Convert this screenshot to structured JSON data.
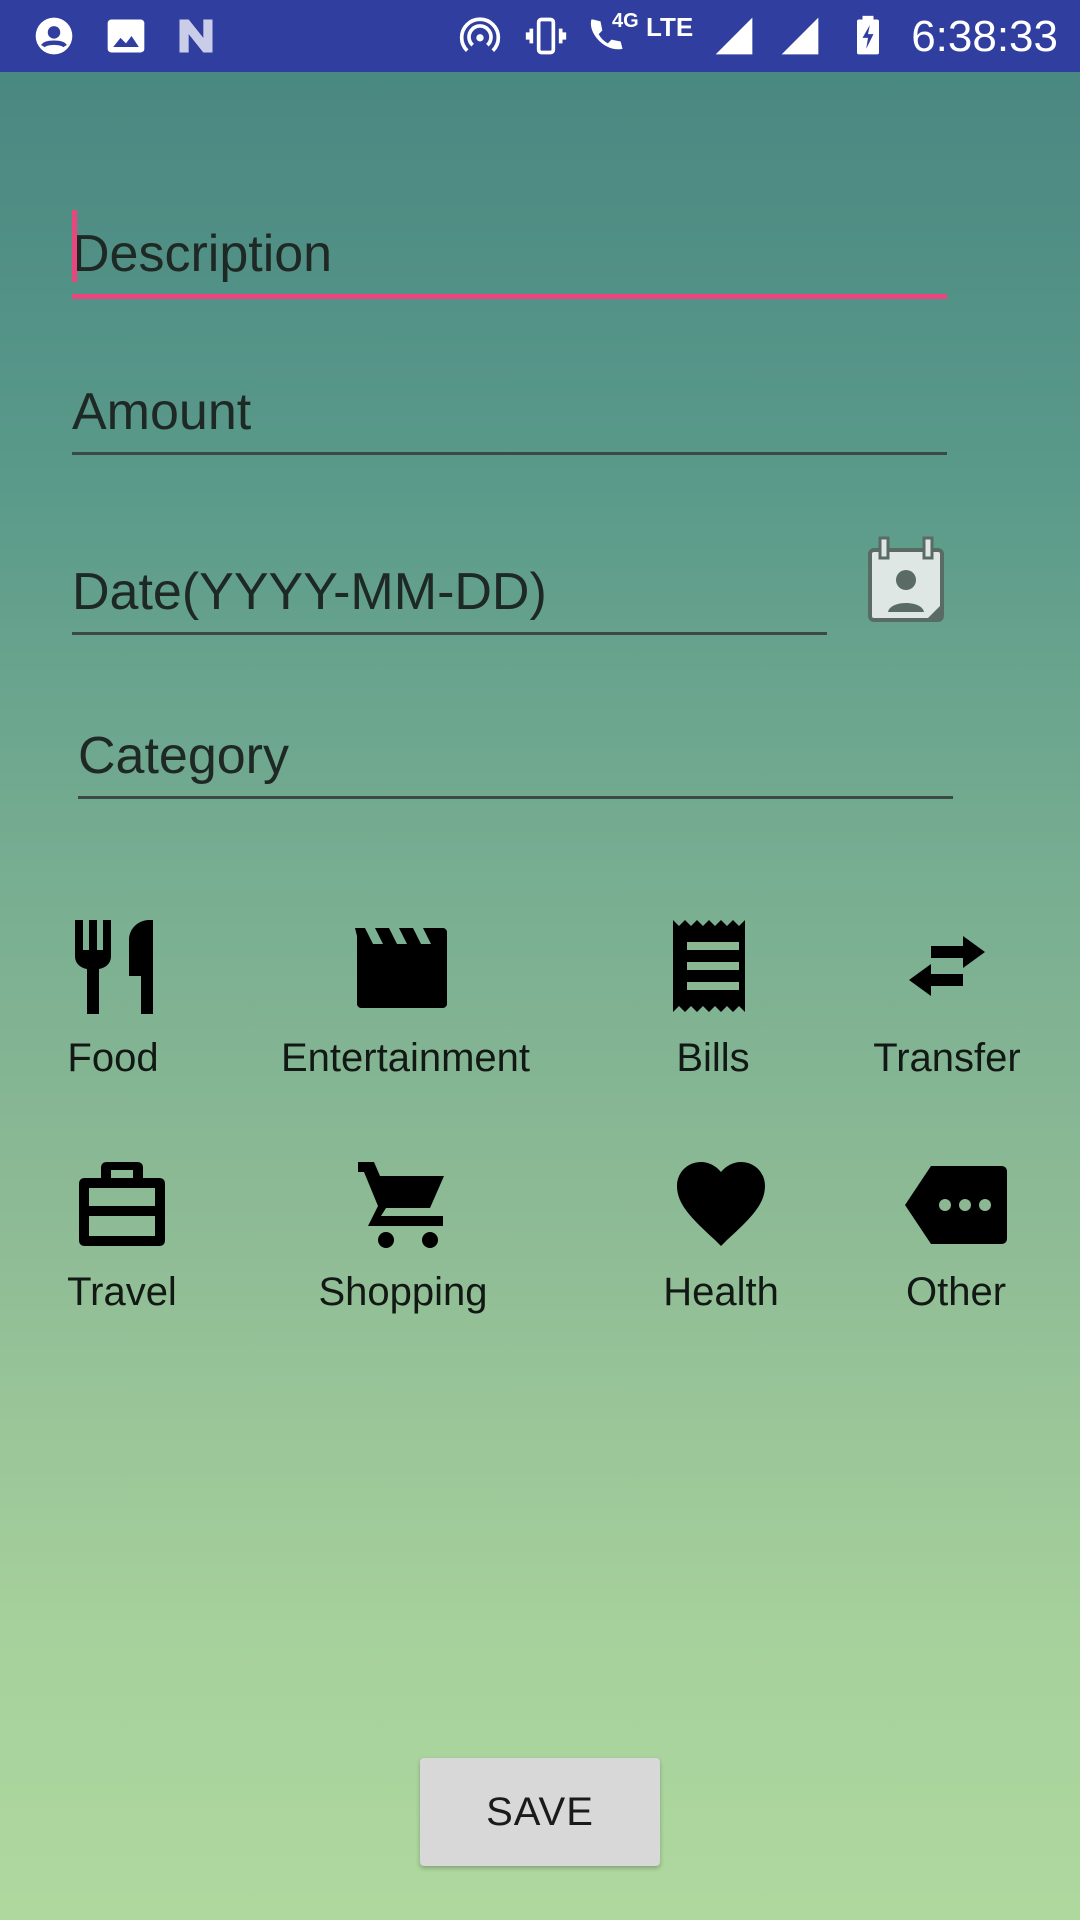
{
  "status_bar": {
    "time": "6:38:33",
    "network_4g": "4G",
    "network_lte": "LTE",
    "icons": [
      "account-circle-icon",
      "image-icon",
      "n-logo-icon",
      "hotspot-icon",
      "vibrate-icon",
      "wifi-call-icon",
      "signal-icon",
      "signal-icon",
      "battery-charging-icon"
    ]
  },
  "form": {
    "description_hint": "Description",
    "amount_hint": "Amount",
    "date_hint": "Date(YYYY-MM-DD)",
    "category_hint": "Category"
  },
  "categories": [
    {
      "label": "Food",
      "icon": "fork-knife-icon"
    },
    {
      "label": "Entertainment",
      "icon": "clapperboard-icon"
    },
    {
      "label": "Bills",
      "icon": "receipt-icon"
    },
    {
      "label": "Transfer",
      "icon": "swap-arrows-icon"
    },
    {
      "label": "Travel",
      "icon": "briefcase-icon"
    },
    {
      "label": "Shopping",
      "icon": "cart-icon"
    },
    {
      "label": "Health",
      "icon": "heart-icon"
    },
    {
      "label": "Other",
      "icon": "tag-more-icon"
    }
  ],
  "save_label": "SAVE",
  "colors": {
    "status_bar": "#303f9f",
    "accent": "#e8467c",
    "button": "#d8d8d8"
  }
}
